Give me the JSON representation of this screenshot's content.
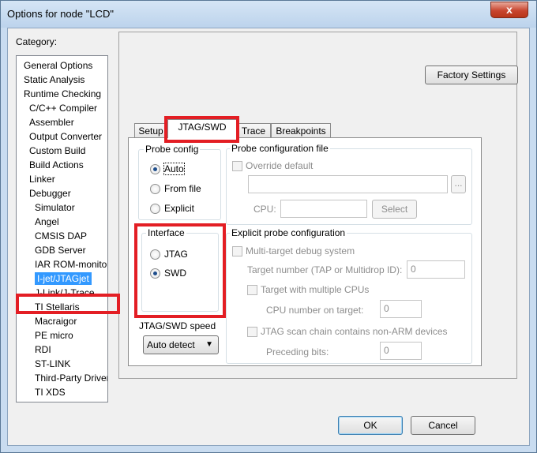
{
  "window": {
    "title": "Options for node \"LCD\"",
    "close_glyph": "x"
  },
  "category": {
    "label": "Category:",
    "items": [
      "General Options",
      "Static Analysis",
      "Runtime Checking",
      "C/C++ Compiler",
      "Assembler",
      "Output Converter",
      "Custom Build",
      "Build Actions",
      "Linker",
      "Debugger",
      "Simulator",
      "Angel",
      "CMSIS DAP",
      "GDB Server",
      "IAR ROM-monitor",
      "I-jet/JTAGjet",
      "J-Link/J-Trace",
      "TI Stellaris",
      "Macraigor",
      "PE micro",
      "RDI",
      "ST-LINK",
      "Third-Party Driver",
      "TI XDS"
    ],
    "selected": "I-jet/JTAGjet"
  },
  "toolbar": {
    "factory_settings": "Factory Settings"
  },
  "tabs": [
    "Setup",
    "JTAG/SWD",
    "Trace",
    "Breakpoints"
  ],
  "active_tab": "JTAG/SWD",
  "probe_config": {
    "title": "Probe config",
    "options": [
      "Auto",
      "From file",
      "Explicit"
    ],
    "selected": "Auto"
  },
  "interface": {
    "title": "Interface",
    "options": [
      "JTAG",
      "SWD"
    ],
    "selected": "SWD"
  },
  "speed": {
    "label": "JTAG/SWD speed",
    "value": "Auto detect"
  },
  "probe_file": {
    "title": "Probe configuration file",
    "override_label": "Override default",
    "path_value": "",
    "browse": "...",
    "cpu_label": "CPU:",
    "cpu_value": "",
    "select_button": "Select"
  },
  "explicit": {
    "title": "Explicit probe configuration",
    "multi_target": "Multi-target debug system",
    "target_number_label": "Target number (TAP or Multidrop ID):",
    "target_number_value": "0",
    "multiple_cpus": "Target with multiple CPUs",
    "cpu_number_label": "CPU number on target:",
    "cpu_number_value": "0",
    "scan_chain": "JTAG scan chain contains non-ARM devices",
    "preceding_bits_label": "Preceding bits:",
    "preceding_bits_value": "0"
  },
  "buttons": {
    "ok": "OK",
    "cancel": "Cancel"
  },
  "highlight_color": "#e31e24"
}
